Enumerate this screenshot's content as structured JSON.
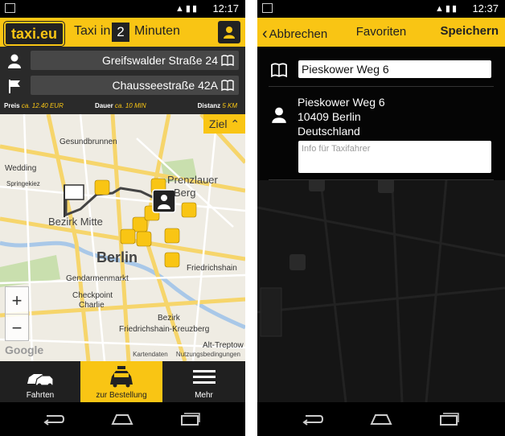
{
  "left_screen": {
    "status_time": "12:17",
    "logo": "taxi.eu",
    "taxi_in": "Taxi in",
    "taxi_minutes_value": "2",
    "taxi_minutes_label": "Minuten",
    "pickup_address": "Greifswalder Straße 24",
    "destination_address": "Chausseestraße 42A",
    "price_label": "Preis",
    "price_value": "ca. 12.40 EUR",
    "duration_label": "Dauer",
    "duration_value": "ca. 10 MIN",
    "distance_label": "Distanz",
    "distance_value": "5 KM",
    "ziel_label": "Ziel",
    "map_labels": {
      "berlin": "Berlin",
      "wedding": "Wedding",
      "gesundbrunnen": "Gesundbrunnen",
      "prenzlauer": "Prenzlauer",
      "berg": "Berg",
      "bezirk_mitte": "Bezirk Mitte",
      "gendarmenmarkt": "Gendarmenmarkt",
      "checkpoint": "Checkpoint",
      "charlie": "Charlie",
      "friedrichshain": "Friedrichshain",
      "bezirk": "Bezirk",
      "friedrichshain_kreuzberg": "Friedrichshain-Kreuzberg",
      "alt_treptow": "Alt-Treptow",
      "springekiez": "Springekiez"
    },
    "zoom_in": "+",
    "zoom_out": "−",
    "google": "Google",
    "kartendaten": "Kartendaten",
    "nutzungsbedingungen": "Nutzungsbedingungen",
    "nav": {
      "fahrten": "Fahrten",
      "bestellung": "zur Bestellung",
      "mehr": "Mehr"
    }
  },
  "right_screen": {
    "status_time": "12:37",
    "cancel_label": "Abbrechen",
    "title": "Favoriten",
    "save_label": "Speichern",
    "favorite_name": "Pieskower Weg 6",
    "address_line1": "Pieskower Weg 6",
    "address_line2": "10409 Berlin",
    "address_line3": "Deutschland",
    "taxi_info_placeholder": "Info für Taxifahrer"
  },
  "colors": {
    "accent": "#f9c514",
    "dark": "#202020"
  }
}
